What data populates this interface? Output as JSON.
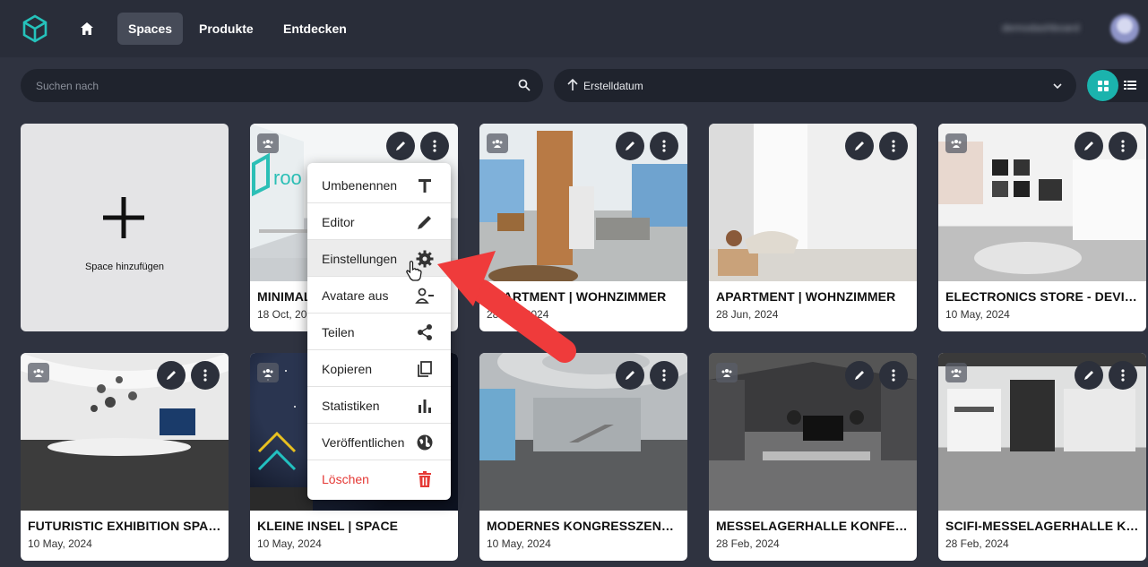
{
  "nav": {
    "home_icon": "home-icon",
    "items": [
      {
        "label": "Spaces",
        "active": true
      },
      {
        "label": "Produkte",
        "active": false
      },
      {
        "label": "Entdecken",
        "active": false
      }
    ],
    "username": "demodashboard"
  },
  "toolbar": {
    "search_placeholder": "Suchen nach",
    "sort_label": "Erstelldatum"
  },
  "add_card": {
    "label": "Space hinzufügen"
  },
  "spaces": [
    {
      "title": "MINIMALISTIC OFFICE SPACE",
      "date": "18 Oct, 2024"
    },
    {
      "title": "APARTMENT | WOHNZIMMER",
      "date": "28 Jun, 2024"
    },
    {
      "title": "APARTMENT | WOHNZIMMER",
      "date": "28 Jun, 2024"
    },
    {
      "title": "ELECTRONICS STORE - DEVICE SHOWROOM",
      "date": "10 May, 2024"
    },
    {
      "title": "FUTURISTIC EXHIBITION SPACE",
      "date": "10 May, 2024"
    },
    {
      "title": "KLEINE INSEL | SPACE",
      "date": "10 May, 2024"
    },
    {
      "title": "MODERNES KONGRESSZENTRUM",
      "date": "10 May, 2024"
    },
    {
      "title": "MESSELAGERHALLE KONFERENZ",
      "date": "28 Feb, 2024"
    },
    {
      "title": "SCIFI-MESSELAGERHALLE KONFERENZ",
      "date": "28 Feb, 2024"
    }
  ],
  "context_menu": {
    "items": [
      {
        "label": "Umbenennen",
        "icon": "text-icon"
      },
      {
        "label": "Editor",
        "icon": "pencil-icon"
      },
      {
        "label": "Einstellungen",
        "icon": "gear-icon"
      },
      {
        "label": "Avatare aus",
        "icon": "person-remove-icon"
      },
      {
        "label": "Teilen",
        "icon": "share-icon"
      },
      {
        "label": "Kopieren",
        "icon": "copy-icon"
      },
      {
        "label": "Statistiken",
        "icon": "bar-chart-icon"
      },
      {
        "label": "Veröffentlichen",
        "icon": "globe-icon"
      },
      {
        "label": "Löschen",
        "icon": "trash-icon"
      }
    ]
  },
  "colors": {
    "background": "#2f3340",
    "accent": "#1bb3ad",
    "danger": "#e53935",
    "annotation_arrow": "#ef3b3b"
  }
}
